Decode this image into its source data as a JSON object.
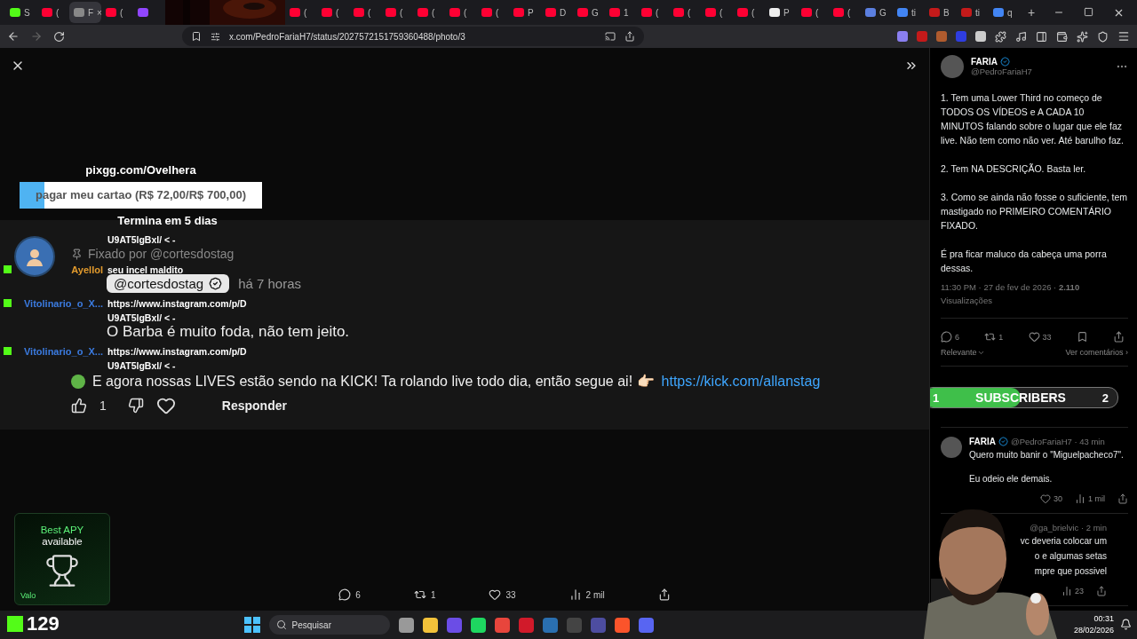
{
  "browser": {
    "tabs_left": [
      {
        "kind": "kick",
        "title": "S",
        "selected": false
      },
      {
        "kind": "youtube",
        "title": "(",
        "selected": false
      },
      {
        "kind": "generic",
        "title": "F",
        "selected": true
      },
      {
        "kind": "youtube",
        "title": "(",
        "selected": false
      },
      {
        "kind": "twitch",
        "selected": false
      }
    ],
    "tabs_right": [
      {
        "kind": "youtube",
        "title": "(",
        "selected": false
      },
      {
        "kind": "youtube",
        "title": "(",
        "selected": false
      },
      {
        "kind": "youtube",
        "title": "(",
        "selected": false
      },
      {
        "kind": "youtube",
        "title": "(",
        "selected": false
      },
      {
        "kind": "youtube",
        "title": "(",
        "selected": false
      },
      {
        "kind": "youtube",
        "title": "(",
        "selected": false
      },
      {
        "kind": "youtube",
        "title": "(",
        "selected": false
      },
      {
        "kind": "youtube",
        "title": "P",
        "selected": false
      },
      {
        "kind": "youtube",
        "title": "D",
        "selected": false
      },
      {
        "kind": "youtube",
        "title": "G",
        "selected": false
      },
      {
        "kind": "youtube",
        "title": "1",
        "selected": false
      },
      {
        "kind": "youtube",
        "title": "(",
        "selected": false
      },
      {
        "kind": "youtube",
        "title": "(",
        "selected": false
      },
      {
        "kind": "youtube",
        "title": "(",
        "selected": false
      },
      {
        "kind": "youtube",
        "title": "(",
        "selected": false
      },
      {
        "kind": "x",
        "title": "P",
        "selected": false
      },
      {
        "kind": "youtube",
        "title": "(",
        "selected": false
      },
      {
        "kind": "youtube",
        "title": "(",
        "selected": false
      },
      {
        "kind": "app",
        "title": "G",
        "selected": false
      },
      {
        "kind": "google",
        "title": "ti",
        "selected": false
      },
      {
        "kind": "am",
        "title": "B",
        "selected": false
      },
      {
        "kind": "am",
        "title": "ti",
        "selected": false
      },
      {
        "kind": "google",
        "title": "q",
        "selected": false
      }
    ],
    "close_tab": "×",
    "new_tab": "+",
    "url": "x.com/PedroFariaH7/status/2027572151759360488/photo/3"
  },
  "overlay": {
    "goal": {
      "site": "pixgg.com/Ovelhera",
      "label": "pagar meu cartao (R$ 72,00/R$ 700,00)",
      "level": 0.103,
      "ends": "Termina em 5 dias"
    },
    "chat": [
      {
        "kind": "continuation",
        "message": "U9AT5lgBxl/ < -"
      },
      {
        "kind": "message",
        "user": "Ayellol",
        "color": "#e39b2d",
        "message": "seu incel maldito"
      },
      {
        "kind": "message",
        "user": "Vitolinario_o_X...",
        "color": "#3b7be0",
        "message": "https://www.instagram.com/p/D"
      },
      {
        "kind": "continuation",
        "message": "U9AT5lgBxl/ < -"
      },
      {
        "kind": "message",
        "user": "Vitolinario_o_X...",
        "color": "#3b7be0",
        "message": "https://www.instagram.com/p/D"
      },
      {
        "kind": "continuation",
        "message": "U9AT5lgBxl/ < -"
      }
    ]
  },
  "comment": {
    "pinned": "Fixado por @cortesdostag",
    "author": "@cortesdostag",
    "verified": true,
    "time": "há 7 horas",
    "text": "O Barba é muito foda, não tem jeito.",
    "promo": "E agora nossas LIVES estão sendo na KICK! Ta rolando live todo dia, então segue ai! 👉🏻",
    "link": "https://kick.com/allanstag",
    "likes": "1",
    "liked": false,
    "reply": "Responder"
  },
  "stats": [
    {
      "kind": "reply",
      "count": "6"
    },
    {
      "kind": "repost",
      "count": "1"
    },
    {
      "kind": "like",
      "count": "33"
    },
    {
      "kind": "views",
      "count": "2 mil"
    },
    {
      "kind": "share"
    }
  ],
  "ad": {
    "title": "Best APY",
    "subtitle": "available",
    "brand": "Valo"
  },
  "tweet": {
    "name": "FARIA",
    "verified": true,
    "handle": "@PedroFariaH7",
    "paragraphs": [
      "1. Tem uma Lower Third no começo de TODOS OS VÍDEOS e A CADA 10 MINUTOS falando sobre o lugar que ele faz live. Não tem como não ver. Até barulho faz.",
      "2. Tem NA DESCRIÇÃO. Basta ler.",
      "3. Como se ainda não fosse o suficiente, tem mastigado no PRIMEIRO COMENTÁRIO FIXADO.",
      "É pra ficar maluco da cabeça uma porra dessas."
    ],
    "meta": "11:30 PM · 27 de fev de 2026 · **2.110**",
    "views_label": "Visualizações",
    "actions": [
      {
        "kind": "reply",
        "count": "6"
      },
      {
        "kind": "repost",
        "count": "1"
      },
      {
        "kind": "like",
        "count": "33"
      },
      {
        "kind": "bookmark"
      },
      {
        "kind": "share"
      }
    ],
    "sort": "Relevante",
    "see_comments": "Ver comentários ›"
  },
  "sub_goal": {
    "current": "1",
    "label": "SUBSCRIBERS",
    "target": "2",
    "level": 0.5
  },
  "replies": [
    {
      "kind": "full",
      "name": "FARIA",
      "verified": true,
      "handle": "@PedroFariaH7 · 43 min",
      "lines": [
        "Quero muito banir o \"Miguelpacheco7\".",
        "Eu odeio ele demais."
      ],
      "actions": [
        {
          "kind": "like",
          "count": "30"
        },
        {
          "kind": "views",
          "count": "1 mil"
        },
        {
          "kind": "share"
        }
      ]
    },
    {
      "kind": "covered",
      "handle": "@ga_brielvic · 2 min",
      "lines": [
        "vc deveria colocar um",
        "o e algumas setas",
        "mpre que possivel"
      ],
      "actions": [
        {
          "kind": "views",
          "count": "23"
        },
        {
          "kind": "share"
        }
      ]
    }
  ],
  "viewer_count": "129",
  "taskbar": {
    "search": "Pesquisar",
    "apps": [
      {
        "kind": "files"
      },
      {
        "kind": "explorer"
      },
      {
        "kind": "grid"
      },
      {
        "kind": "spotify"
      },
      {
        "kind": "chrome"
      },
      {
        "kind": "opera"
      },
      {
        "kind": "steam"
      },
      {
        "kind": "obs"
      },
      {
        "kind": "arrow"
      },
      {
        "kind": "brave"
      },
      {
        "kind": "discord"
      }
    ],
    "time": "00:31",
    "date": "28/02/2026"
  }
}
